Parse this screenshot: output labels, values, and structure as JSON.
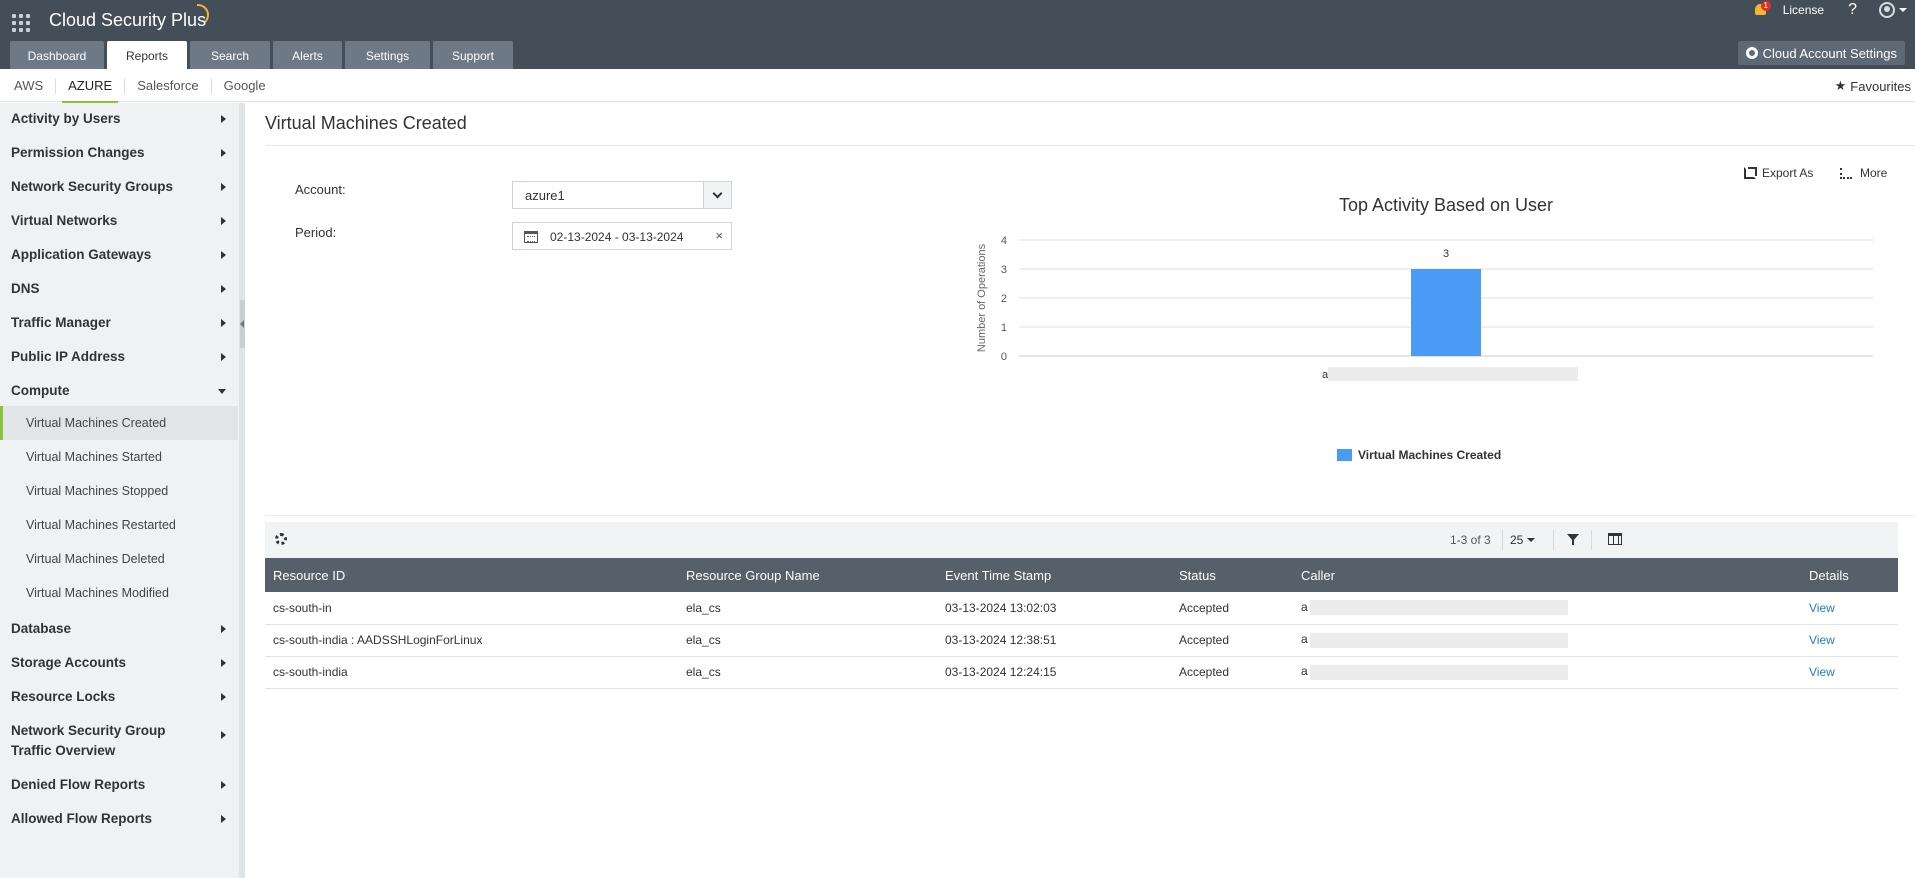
{
  "app": {
    "title": "Cloud Security Plus",
    "notification_count": "1",
    "license_label": "License",
    "help_label": "?"
  },
  "tabs": [
    "Dashboard",
    "Reports",
    "Search",
    "Alerts",
    "Settings",
    "Support"
  ],
  "active_tab": "Reports",
  "cloud_account_settings_label": "Cloud Account Settings",
  "subtabs": [
    "AWS",
    "AZURE",
    "Salesforce",
    "Google"
  ],
  "active_subtab": "AZURE",
  "favourites_label": "Favourites",
  "sidebar": {
    "items": [
      {
        "label": "Activity by Users"
      },
      {
        "label": "Permission Changes"
      },
      {
        "label": "Network Security Groups"
      },
      {
        "label": "Virtual Networks"
      },
      {
        "label": "Application Gateways"
      },
      {
        "label": "DNS"
      },
      {
        "label": "Traffic Manager"
      },
      {
        "label": "Public IP Address"
      },
      {
        "label": "Compute",
        "open": true,
        "children": [
          "Virtual Machines Created",
          "Virtual Machines Started",
          "Virtual Machines Stopped",
          "Virtual Machines Restarted",
          "Virtual Machines Deleted",
          "Virtual Machines Modified"
        ]
      },
      {
        "label": "Database"
      },
      {
        "label": "Storage Accounts"
      },
      {
        "label": "Resource Locks"
      },
      {
        "label": "Network Security Group Traffic Overview"
      },
      {
        "label": "Denied Flow Reports"
      },
      {
        "label": "Allowed Flow Reports"
      }
    ],
    "active_child": "Virtual Machines Created"
  },
  "report": {
    "title": "Virtual Machines Created",
    "account_label": "Account:",
    "account_value": "azure1",
    "period_label": "Period:",
    "period_value": "02-13-2024 - 03-13-2024",
    "export_label": "Export As",
    "more_label": "More"
  },
  "chart_data": {
    "type": "bar",
    "title": "Top Activity Based on User",
    "ylabel": "Number of Operations",
    "xlabel": "",
    "categories": [
      "a"
    ],
    "series": [
      {
        "name": "Virtual Machines Created",
        "values": [
          3
        ],
        "color": "#4a9bf5"
      }
    ],
    "ylim": [
      0,
      4
    ],
    "yticks": [
      0,
      1,
      2,
      3,
      4
    ],
    "grid": true,
    "legend": "bottom-center",
    "data_labels": true
  },
  "table": {
    "pager_text": "1-3 of 3",
    "page_size": "25",
    "columns": [
      "Resource ID",
      "Resource Group Name",
      "Event Time Stamp",
      "Status",
      "Caller",
      "Details"
    ],
    "rows": [
      {
        "resource_id": "cs-south-in",
        "group": "ela_cs",
        "timestamp": "03-13-2024 13:02:03",
        "status": "Accepted",
        "caller": "a",
        "details": "View"
      },
      {
        "resource_id": "cs-south-india : AADSSHLoginForLinux",
        "group": "ela_cs",
        "timestamp": "03-13-2024 12:38:51",
        "status": "Accepted",
        "caller": "a",
        "details": "View"
      },
      {
        "resource_id": "cs-south-india",
        "group": "ela_cs",
        "timestamp": "03-13-2024 12:24:15",
        "status": "Accepted",
        "caller": "a",
        "details": "View"
      }
    ]
  }
}
